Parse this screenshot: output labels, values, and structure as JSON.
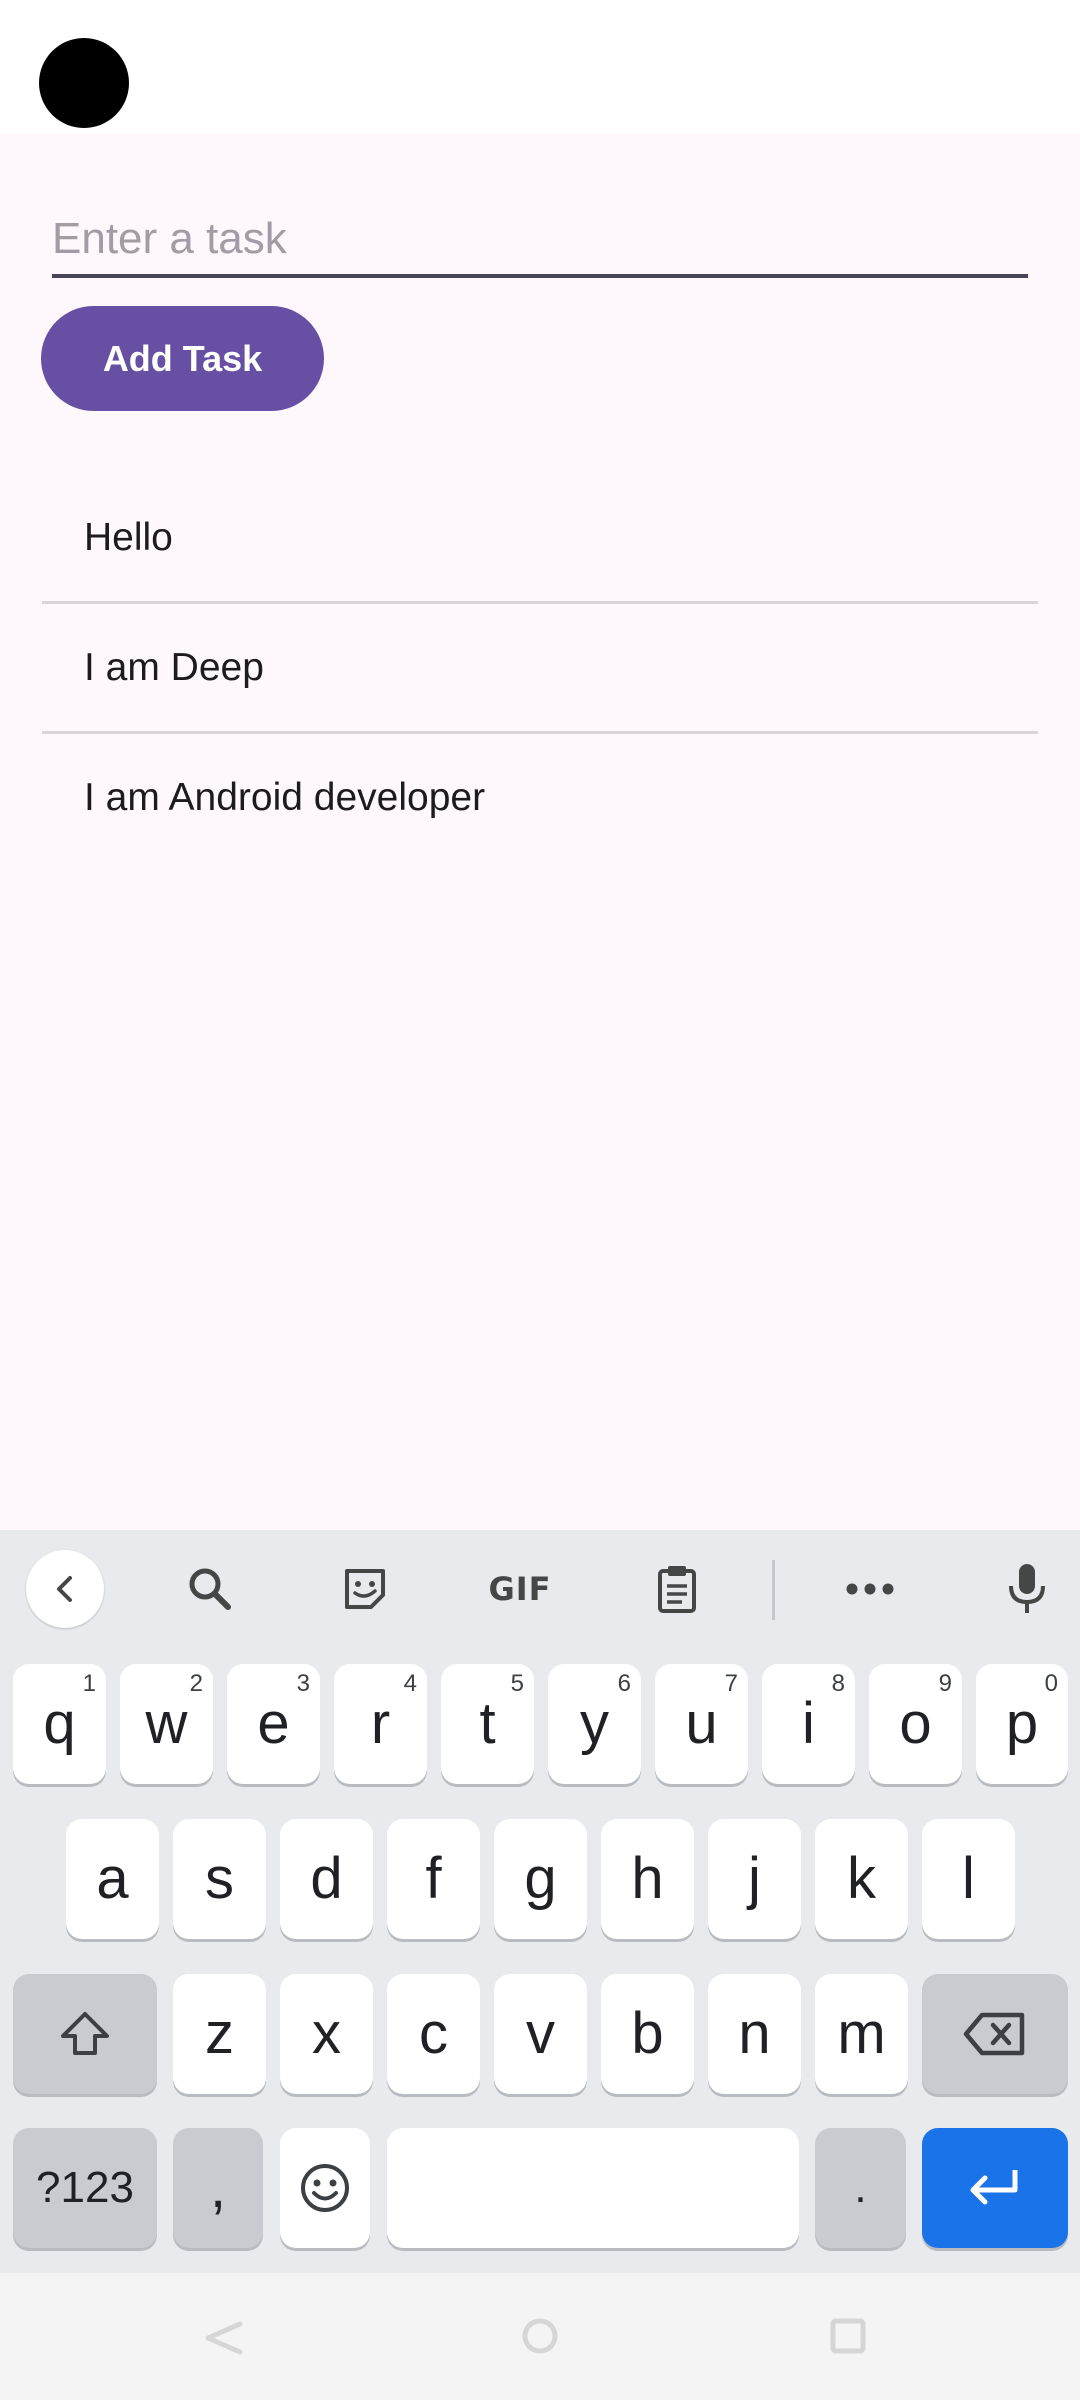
{
  "app": {
    "input": {
      "placeholder": "Enter a task",
      "value": ""
    },
    "add_button_label": "Add Task",
    "tasks": [
      "Hello",
      "I am Deep",
      "I am Android developer"
    ]
  },
  "keyboard": {
    "toolbar": [
      "back-icon",
      "search-icon",
      "sticker-icon",
      "GIF",
      "clipboard-icon",
      "more-icon",
      "microphone-icon"
    ],
    "gif_label": "GIF",
    "row1": [
      {
        "key": "q",
        "hint": "1"
      },
      {
        "key": "w",
        "hint": "2"
      },
      {
        "key": "e",
        "hint": "3"
      },
      {
        "key": "r",
        "hint": "4"
      },
      {
        "key": "t",
        "hint": "5"
      },
      {
        "key": "y",
        "hint": "6"
      },
      {
        "key": "u",
        "hint": "7"
      },
      {
        "key": "i",
        "hint": "8"
      },
      {
        "key": "o",
        "hint": "9"
      },
      {
        "key": "p",
        "hint": "0"
      }
    ],
    "row2": [
      "a",
      "s",
      "d",
      "f",
      "g",
      "h",
      "j",
      "k",
      "l"
    ],
    "row3": [
      "z",
      "x",
      "c",
      "v",
      "b",
      "n",
      "m"
    ],
    "symbols_label": "?123",
    "comma_label": ",",
    "period_label": "."
  },
  "colors": {
    "accent": "#6750a4",
    "enter": "#1a73e8",
    "background": "#fef7fb"
  }
}
